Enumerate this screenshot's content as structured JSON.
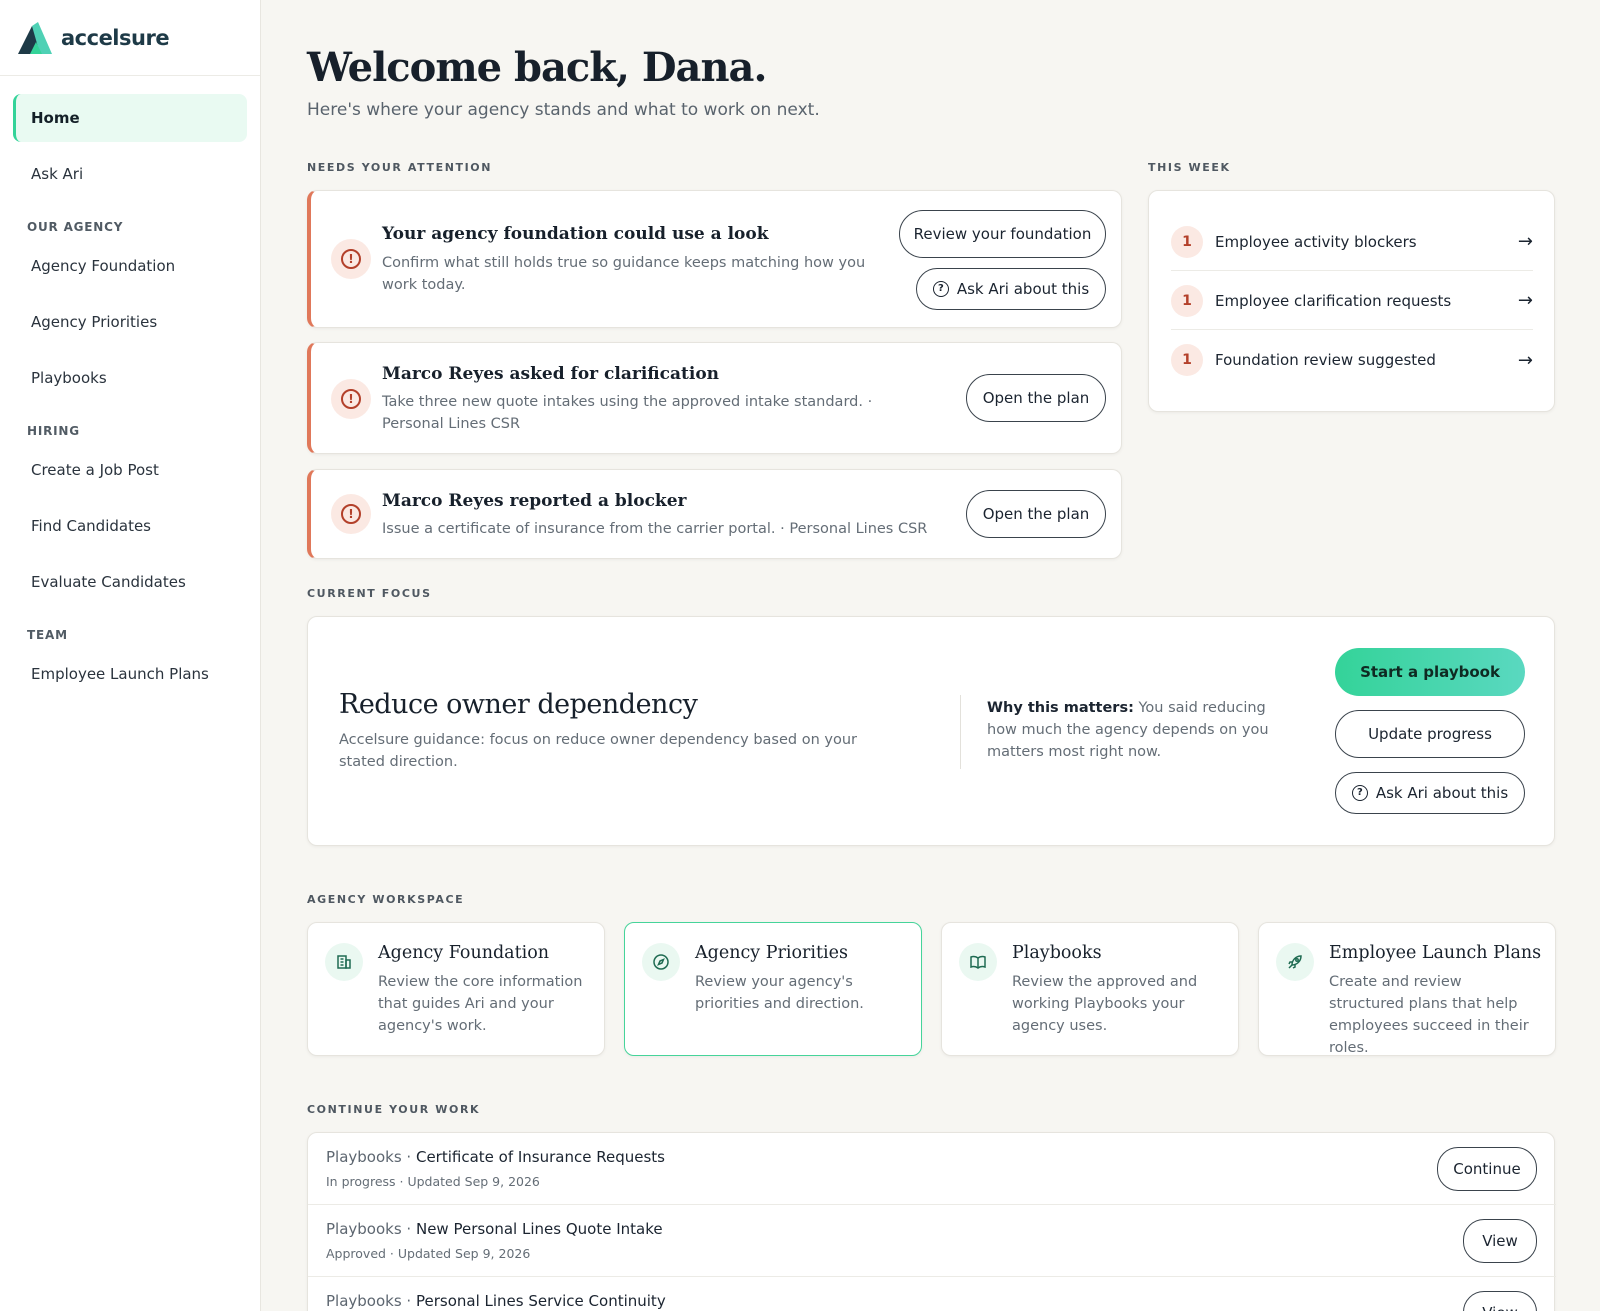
{
  "brand": {
    "name": "accelsure"
  },
  "sidebar": {
    "items": [
      {
        "label": "Home"
      },
      {
        "label": "Ask Ari"
      }
    ],
    "sections": [
      {
        "label": "OUR AGENCY",
        "items": [
          {
            "label": "Agency Foundation"
          },
          {
            "label": "Agency Priorities"
          },
          {
            "label": "Playbooks"
          }
        ]
      },
      {
        "label": "HIRING",
        "items": [
          {
            "label": "Create a Job Post"
          },
          {
            "label": "Find Candidates"
          },
          {
            "label": "Evaluate Candidates"
          }
        ]
      },
      {
        "label": "TEAM",
        "items": [
          {
            "label": "Employee Launch Plans"
          }
        ]
      }
    ]
  },
  "header": {
    "title": "Welcome back, Dana.",
    "subtitle": "Here's where your agency stands and what to work on next."
  },
  "attention": {
    "label": "NEEDS YOUR ATTENTION",
    "items": [
      {
        "title": "Your agency foundation could use a look",
        "description": "Confirm what still holds true so guidance keeps matching how you work today.",
        "primary_action": "Review your foundation",
        "secondary_action": "Ask Ari about this"
      },
      {
        "title": "Marco Reyes asked for clarification",
        "description": "Take three new quote intakes using the approved intake standard. · Personal Lines CSR",
        "primary_action": "Open the plan"
      },
      {
        "title": "Marco Reyes reported a blocker",
        "description": "Issue a certificate of insurance from the carrier portal. · Personal Lines CSR",
        "primary_action": "Open the plan"
      }
    ]
  },
  "this_week": {
    "label": "THIS WEEK",
    "items": [
      {
        "count": "1",
        "label": "Employee activity blockers"
      },
      {
        "count": "1",
        "label": "Employee clarification requests"
      },
      {
        "count": "1",
        "label": "Foundation review suggested"
      }
    ]
  },
  "focus": {
    "label": "CURRENT FOCUS",
    "title": "Reduce owner dependency",
    "description": "Accelsure guidance: focus on reduce owner dependency based on your stated direction.",
    "why_label": "Why this matters:",
    "why_text": " You said reducing how much the agency depends on you matters most right now.",
    "actions": {
      "start": "Start a playbook",
      "update": "Update progress",
      "ask": "Ask Ari about this"
    }
  },
  "workspace": {
    "label": "AGENCY WORKSPACE",
    "cards": [
      {
        "title": "Agency Foundation",
        "description": "Review the core information that guides Ari and your agency's work.",
        "icon": "building-icon"
      },
      {
        "title": "Agency Priorities",
        "description": "Review your agency's priorities and direction.",
        "icon": "compass-icon"
      },
      {
        "title": "Playbooks",
        "description": "Review the approved and working Playbooks your agency uses.",
        "icon": "book-icon"
      },
      {
        "title": "Employee Launch Plans",
        "description": "Create and review structured plans that help employees succeed in their roles.",
        "icon": "rocket-icon"
      }
    ]
  },
  "continue_work": {
    "label": "CONTINUE YOUR WORK",
    "items": [
      {
        "category": "Playbooks · ",
        "title": "Certificate of Insurance Requests",
        "meta": "In progress · Updated Sep 9, 2026",
        "action": "Continue"
      },
      {
        "category": "Playbooks · ",
        "title": "New Personal Lines Quote Intake",
        "meta": "Approved · Updated Sep 9, 2026",
        "action": "View"
      },
      {
        "category": "Playbooks · ",
        "title": "Personal Lines Service Continuity",
        "meta": "",
        "action": "View"
      }
    ]
  },
  "colors": {
    "accent": "#34d399",
    "alert": "#e0785a",
    "text": "#17202b"
  }
}
